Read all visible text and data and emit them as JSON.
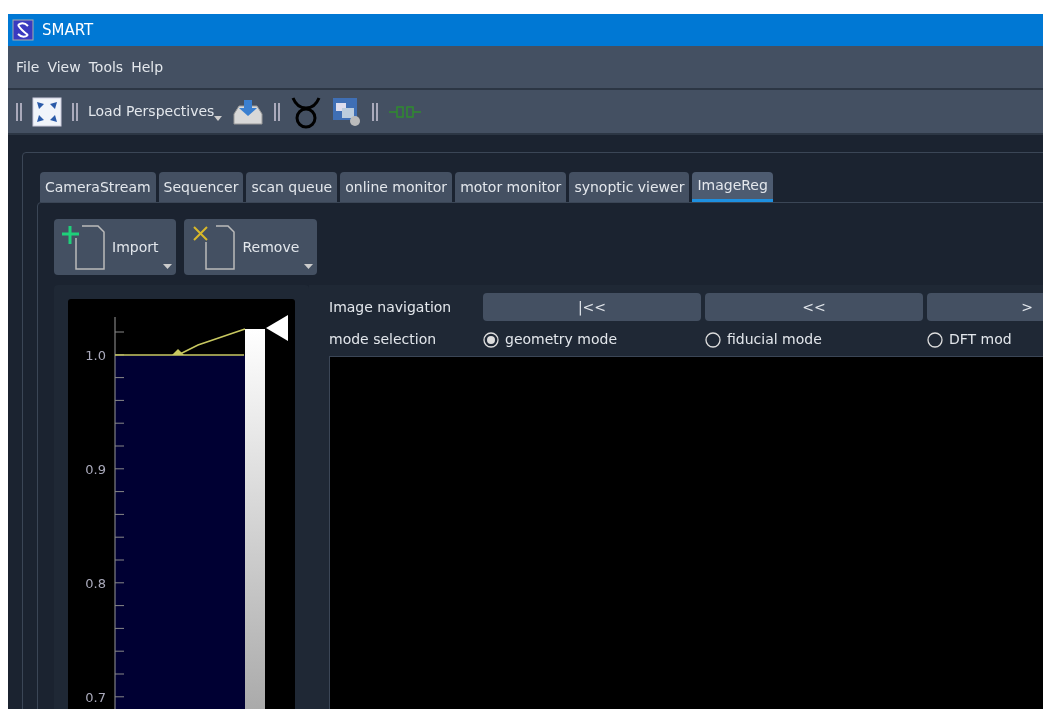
{
  "window": {
    "title": "SMART"
  },
  "menu": [
    "File",
    "View",
    "Tools",
    "Help"
  ],
  "toolbar": {
    "load_perspectives": "Load Perspectives"
  },
  "tabs": [
    {
      "label": "CameraStream",
      "selected": false
    },
    {
      "label": "Sequencer",
      "selected": false
    },
    {
      "label": "scan queue",
      "selected": false
    },
    {
      "label": "online monitor",
      "selected": false
    },
    {
      "label": "motor monitor",
      "selected": false
    },
    {
      "label": "synoptic viewer",
      "selected": false
    },
    {
      "label": "ImageReg",
      "selected": true
    }
  ],
  "actions": [
    {
      "label": "Import",
      "kind": "add"
    },
    {
      "label": "Remove",
      "kind": "remove"
    }
  ],
  "histogram": {
    "axis_labels": [
      "1.0",
      "0.9",
      "0.8",
      "0.7"
    ]
  },
  "navigation": {
    "label": "Image navigation",
    "buttons": [
      "|<<",
      "<<",
      ">"
    ]
  },
  "mode_selection": {
    "label": "mode selection",
    "options": [
      {
        "label": "geometry mode",
        "selected": true
      },
      {
        "label": "fiducial mode",
        "selected": false
      },
      {
        "label": "DFT mod",
        "selected": false
      }
    ]
  }
}
